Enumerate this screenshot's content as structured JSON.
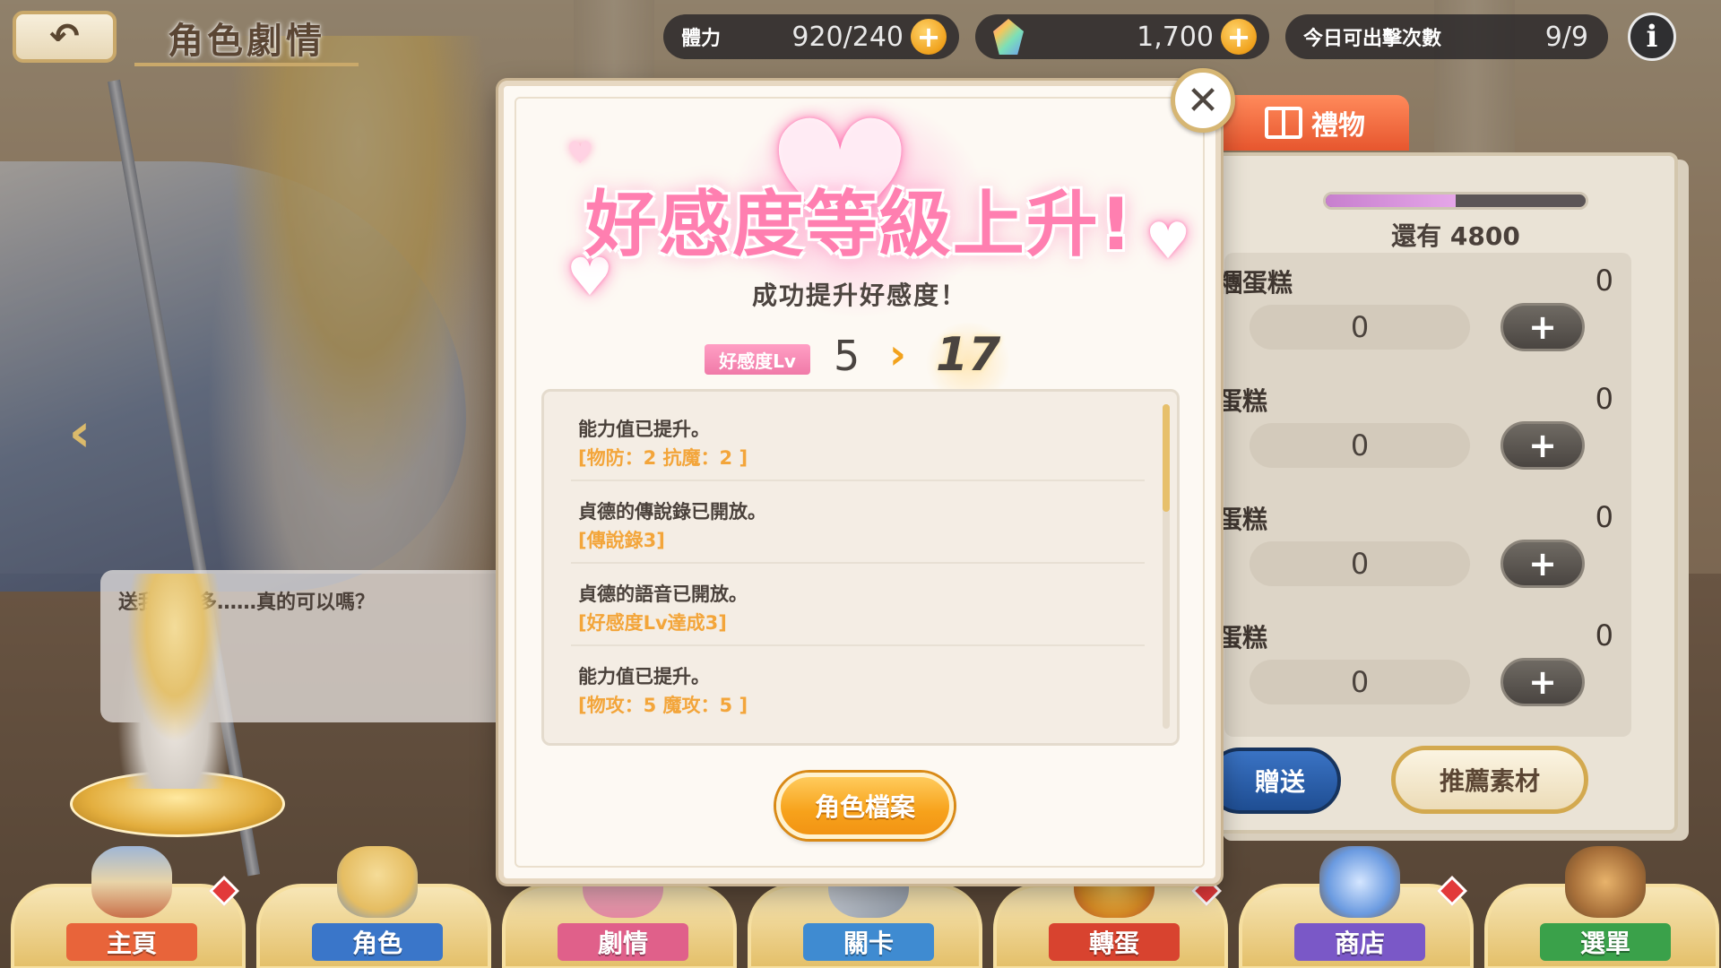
{
  "header": {
    "back_icon": "undo-arrow-icon",
    "title": "角色劇情",
    "stamina_label": "體力",
    "stamina_value": "920/240",
    "gem_value": "1,700",
    "attacks_label": "今日可出擊次數",
    "attacks_value": "9/9",
    "info_icon": "i"
  },
  "scene": {
    "speech": "送我這麼多……真的可以嗎？",
    "prev_arrow": "‹"
  },
  "gift_panel": {
    "tab_label": "禮物",
    "remaining_text": "還有 4800",
    "progress_fraction": 0.5,
    "cakes": [
      {
        "name": "糰蛋糕",
        "owned": "0",
        "qty": "0",
        "plus": "+"
      },
      {
        "name": "蛋糕",
        "owned": "0",
        "qty": "0",
        "plus": "+"
      },
      {
        "name": "蛋糕",
        "owned": "0",
        "qty": "0",
        "plus": "+"
      },
      {
        "name": "蛋糕",
        "owned": "0",
        "qty": "0",
        "plus": "+"
      }
    ],
    "send_label": "贈送",
    "recommend_label": "推薦素材"
  },
  "modal": {
    "title": "好感度等級上升!",
    "subtitle": "成功提升好感度！",
    "lv_badge": "好感度Lv",
    "old_level": "5",
    "arrow": "›",
    "new_level": "17",
    "rewards": [
      {
        "title": "能力值已提升。",
        "detail": "[物防：2 抗魔：2 ]"
      },
      {
        "title": "貞德的傳說錄已開放。",
        "detail": "[傳說錄3]"
      },
      {
        "title": "貞德的語音已開放。",
        "detail": "[好感度Lv達成3]"
      },
      {
        "title": "能力值已提升。",
        "detail": "[物攻：5 魔攻：5 ]"
      }
    ],
    "profile_button": "角色檔案",
    "close": "✕"
  },
  "bottom_nav": [
    {
      "label": "主頁",
      "icon": "castle-icon",
      "badge": true,
      "color": "#e8643a"
    },
    {
      "label": "角色",
      "icon": "character-portrait-icon",
      "badge": false,
      "color": "#3a76c9"
    },
    {
      "label": "劇情",
      "icon": "story-book-icon",
      "badge": false,
      "color": "#e0608a"
    },
    {
      "label": "關卡",
      "icon": "crossed-swords-icon",
      "badge": false,
      "color": "#3f8bd1"
    },
    {
      "label": "轉蛋",
      "icon": "gacha-crown-icon",
      "badge": true,
      "color": "#d8432f"
    },
    {
      "label": "商店",
      "icon": "shop-crystal-icon",
      "badge": true,
      "color": "#7a58c7"
    },
    {
      "label": "選單",
      "icon": "menu-bag-icon",
      "badge": false,
      "color": "#3aa14a"
    }
  ],
  "colors": {
    "accent_pink": "#ff7fb0",
    "reward_detail": "#f3a53a",
    "button_orange": "#f7a21b"
  }
}
